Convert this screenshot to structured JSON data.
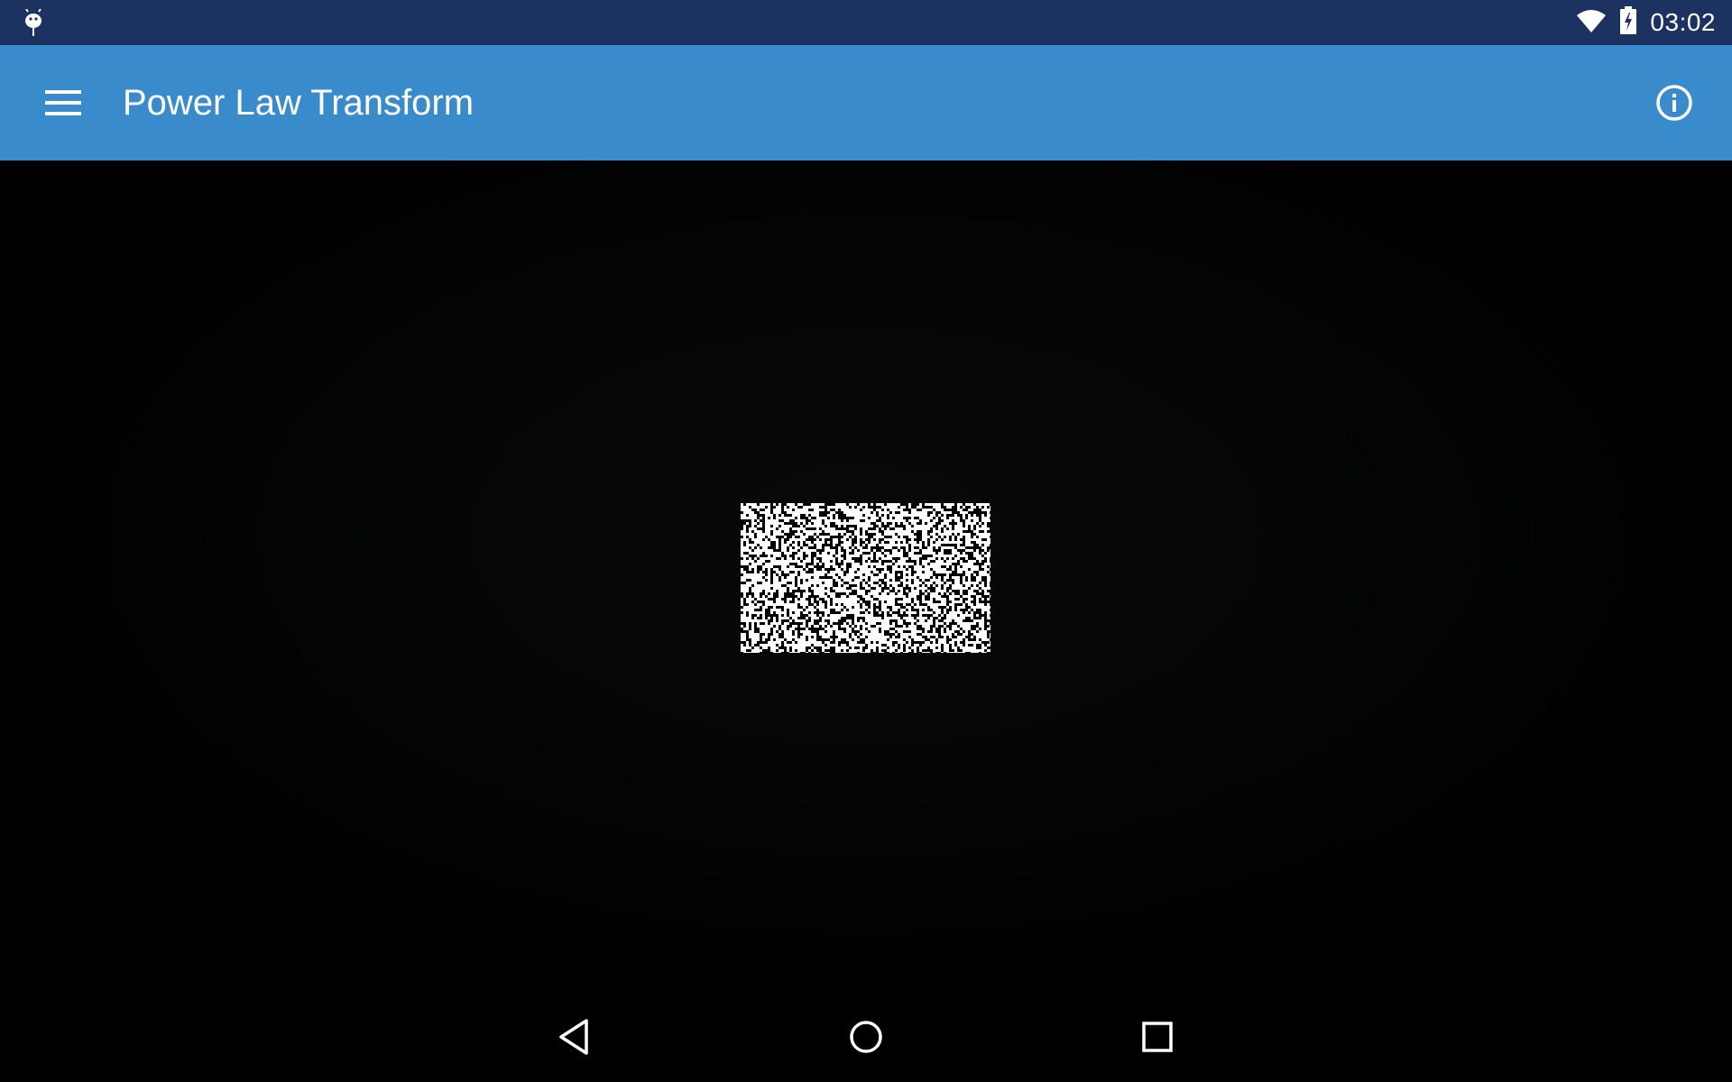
{
  "status_bar": {
    "time": "03:02",
    "icons": [
      "android-debug-icon",
      "wifi-icon",
      "battery-charging-icon"
    ]
  },
  "app_bar": {
    "title": "Power Law Transform",
    "menu_icon": "hamburger-menu-icon",
    "info_icon": "info-icon",
    "color": "#3a8bcb"
  },
  "content": {
    "image_description_icon": "processed-noise-image"
  },
  "nav_bar": {
    "icons": [
      "back-icon",
      "home-icon",
      "recents-icon"
    ]
  },
  "colors": {
    "status_bar": "#1c3260",
    "app_bar": "#3a8bcb",
    "content_bg": "#000000"
  }
}
